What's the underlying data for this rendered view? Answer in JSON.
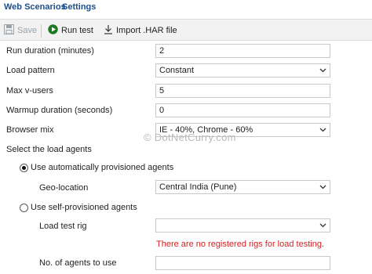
{
  "tabs": {
    "web_scenarios": "Web Scenarios",
    "settings": "Settings"
  },
  "toolbar": {
    "save": "Save",
    "run_test": "Run test",
    "import_har": "Import .HAR file"
  },
  "form": {
    "run_duration": {
      "label": "Run duration (minutes)",
      "value": "2"
    },
    "load_pattern": {
      "label": "Load pattern",
      "value": "Constant"
    },
    "max_vusers": {
      "label": "Max v-users",
      "value": "5"
    },
    "warmup_duration": {
      "label": "Warmup duration (seconds)",
      "value": "0"
    },
    "browser_mix": {
      "label": "Browser mix",
      "value": "IE - 40%, Chrome - 60%"
    },
    "select_agents_label": "Select the load agents",
    "auto_agents": {
      "label": "Use automatically provisioned agents",
      "checked": true
    },
    "geo_location": {
      "label": "Geo-location",
      "value": "Central India (Pune)"
    },
    "self_agents": {
      "label": "Use self-provisioned agents",
      "checked": false
    },
    "load_test_rig": {
      "label": "Load test rig",
      "value": ""
    },
    "no_rigs_error": "There are no registered rigs for load testing.",
    "num_agents": {
      "label": "No. of agents to use",
      "value": ""
    }
  },
  "watermark": "© DotNetCurry.com",
  "colors": {
    "tab_text": "#1e4f8c",
    "run_icon": "#1e7a1e",
    "error_text": "#d81e1e"
  }
}
